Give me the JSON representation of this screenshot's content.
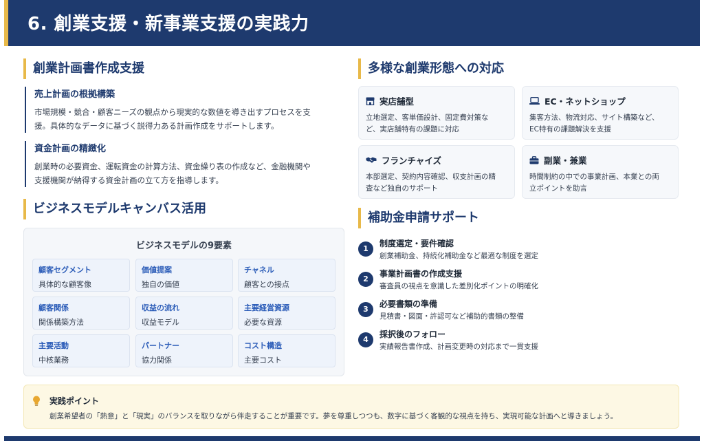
{
  "header": {
    "title": "6. 創業支援・新事業支援の実践力"
  },
  "plan_section": {
    "title": "創業計画書作成支援",
    "blocks": [
      {
        "title": "売上計画の根拠構築",
        "lines": [
          "市場規模・競合・顧客ニーズの観点から現実的な数値を導き出すプロセスを支",
          "援。具体的なデータに基づく説得力ある計画作成をサポートします。"
        ]
      },
      {
        "title": "資金計画の精緻化",
        "lines": [
          "創業時の必要資金、運転資金の計算方法、資金繰り表の作成など、金融機関や",
          "支援機関が納得する資金計画の立て方を指導します。"
        ]
      }
    ]
  },
  "bmc_section": {
    "title": "ビジネスモデルキャンバス活用",
    "panel_title": "ビジネスモデルの9要素",
    "cells": [
      {
        "title": "顧客セグメント",
        "desc": "具体的な顧客像"
      },
      {
        "title": "価値提案",
        "desc": "独自の価値"
      },
      {
        "title": "チャネル",
        "desc": "顧客との接点"
      },
      {
        "title": "顧客関係",
        "desc": "関係構築方法"
      },
      {
        "title": "収益の流れ",
        "desc": "収益モデル"
      },
      {
        "title": "主要経営資源",
        "desc": "必要な資源"
      },
      {
        "title": "主要活動",
        "desc": "中核業務"
      },
      {
        "title": "パートナー",
        "desc": "協力関係"
      },
      {
        "title": "コスト構造",
        "desc": "主要コスト"
      }
    ]
  },
  "forms_section": {
    "title": "多様な創業形態への対応",
    "cards": [
      {
        "icon": "store-icon",
        "title": "実店舗型",
        "lines": [
          "立地選定、客単価設計、固定費対策な",
          "ど、実店舗特有の課題に対応"
        ]
      },
      {
        "icon": "laptop-icon",
        "title": "EC・ネットショップ",
        "lines": [
          "集客方法、物流対応、サイト構築など、",
          "EC特有の課題解決を支援"
        ]
      },
      {
        "icon": "handshake-icon",
        "title": "フランチャイズ",
        "lines": [
          "本部選定、契約内容確認、収支計画の精",
          "査など独自のサポート"
        ]
      },
      {
        "icon": "briefcase-icon",
        "title": "副業・兼業",
        "lines": [
          "時間制約の中での事業計画、本業との両",
          "立ポイントを助言"
        ]
      }
    ]
  },
  "subsidy_section": {
    "title": "補助金申請サポート",
    "steps": [
      {
        "num": "1",
        "title": "制度選定・要件確認",
        "desc": "創業補助金、持続化補助金など最適な制度を選定"
      },
      {
        "num": "2",
        "title": "事業計画書の作成支援",
        "desc": "審査員の視点を意識した差別化ポイントの明確化"
      },
      {
        "num": "3",
        "title": "必要書類の準備",
        "desc": "見積書・図面・許認可など補助的書類の整備"
      },
      {
        "num": "4",
        "title": "採択後のフォロー",
        "desc": "実績報告書作成、計画変更時の対応まで一貫支援"
      }
    ]
  },
  "tip": {
    "icon": "lightbulb-icon",
    "title": "実践ポイント",
    "text": "創業希望者の「熱意」と「現実」のバランスを取りながら伴走することが重要です。夢を尊重しつつも、数字に基づく客観的な視点を持ち、実現可能な計画へと導きましょう。"
  },
  "colors": {
    "navy": "#1e3a6e",
    "accent": "#e8b949",
    "link_blue": "#2b5cb8"
  }
}
